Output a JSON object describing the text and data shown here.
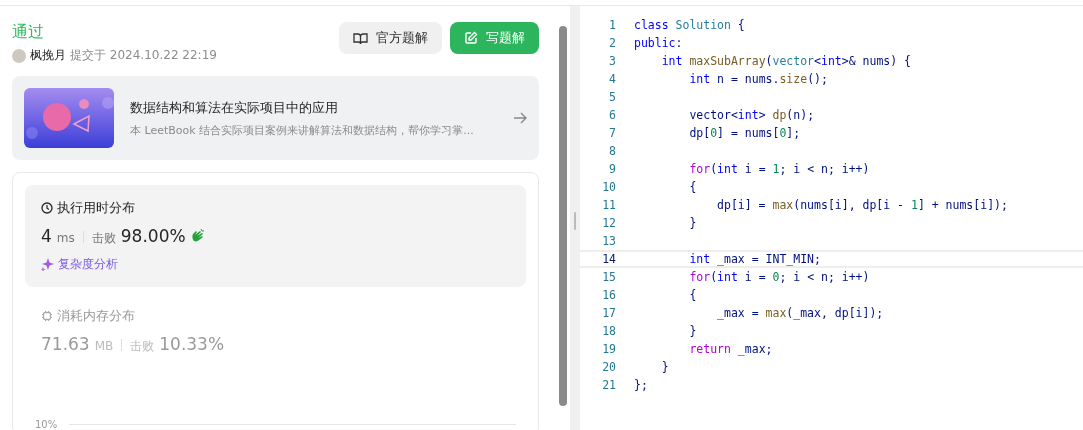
{
  "submission": {
    "status": "通过",
    "author": "枫挽月",
    "submitted": "提交于 2024.10.22 22:19"
  },
  "buttons": [
    {
      "kind": "secondary",
      "label": "官方题解"
    },
    {
      "kind": "primary",
      "label": "写题解"
    }
  ],
  "promo": {
    "title": "数据结构和算法在实际项目中的应用",
    "subtitle": "本 LeetBook 结合实际项目案例来讲解算法和数据结构，帮你学习掌..."
  },
  "stats": [
    {
      "kind": "time",
      "selected": true,
      "title": "执行用时分布",
      "value": "4",
      "unit": "ms",
      "beats_label": "击败",
      "beats": "98.00%",
      "link": "复杂度分析"
    },
    {
      "kind": "memory",
      "selected": false,
      "title": "消耗内存分布",
      "value": "71.63",
      "unit": "MB",
      "beats_label": "击败",
      "beats": "10.33%"
    }
  ],
  "chart": {
    "ytick_label": "10%"
  },
  "code": [
    {
      "number": "1",
      "current": false,
      "tokens": [
        {
          "kind": "keyword",
          "text": "class"
        },
        {
          "kind": "type",
          "text": " Solution"
        },
        {
          "kind": "plain",
          "text": " {"
        }
      ]
    },
    {
      "number": "2",
      "current": false,
      "tokens": [
        {
          "kind": "keyword",
          "text": "public"
        },
        {
          "kind": "plain",
          "text": ":"
        }
      ]
    },
    {
      "number": "3",
      "current": false,
      "tokens": [
        {
          "kind": "keyword",
          "text": "    int"
        },
        {
          "kind": "func",
          "text": " maxSubArray"
        },
        {
          "kind": "plain",
          "text": "("
        },
        {
          "kind": "type",
          "text": "vector"
        },
        {
          "kind": "plain",
          "text": "<"
        },
        {
          "kind": "keyword",
          "text": "int"
        },
        {
          "kind": "plain",
          "text": ">& nums) {"
        }
      ]
    },
    {
      "number": "4",
      "current": false,
      "tokens": [
        {
          "kind": "keyword",
          "text": "        int"
        },
        {
          "kind": "plain",
          "text": " n = nums."
        },
        {
          "kind": "func",
          "text": "size"
        },
        {
          "kind": "plain",
          "text": "();"
        }
      ]
    },
    {
      "number": "5",
      "current": false
    },
    {
      "number": "6",
      "current": false,
      "tokens": [
        {
          "kind": "plain",
          "text": "        vector<"
        },
        {
          "kind": "keyword",
          "text": "int"
        },
        {
          "kind": "plain",
          "text": "> "
        },
        {
          "kind": "func",
          "text": "dp"
        },
        {
          "kind": "plain",
          "text": "(n);"
        }
      ]
    },
    {
      "number": "7",
      "current": false,
      "tokens": [
        {
          "kind": "plain",
          "text": "        dp["
        },
        {
          "kind": "number",
          "text": "0"
        },
        {
          "kind": "plain",
          "text": "] = nums["
        },
        {
          "kind": "number",
          "text": "0"
        },
        {
          "kind": "plain",
          "text": "];"
        }
      ]
    },
    {
      "number": "8",
      "current": false
    },
    {
      "number": "9",
      "current": false,
      "tokens": [
        {
          "kind": "control",
          "text": "        for"
        },
        {
          "kind": "plain",
          "text": "("
        },
        {
          "kind": "keyword",
          "text": "int"
        },
        {
          "kind": "plain",
          "text": " i = "
        },
        {
          "kind": "number",
          "text": "1"
        },
        {
          "kind": "plain",
          "text": "; i < n; i++)"
        }
      ]
    },
    {
      "number": "10",
      "current": false,
      "tokens": [
        {
          "kind": "plain",
          "text": "        {"
        }
      ]
    },
    {
      "number": "11",
      "current": false,
      "tokens": [
        {
          "kind": "plain",
          "text": "            dp[i] = "
        },
        {
          "kind": "func",
          "text": "max"
        },
        {
          "kind": "plain",
          "text": "(nums[i], dp[i - "
        },
        {
          "kind": "number",
          "text": "1"
        },
        {
          "kind": "plain",
          "text": "] + nums[i]);"
        }
      ]
    },
    {
      "number": "12",
      "current": false,
      "tokens": [
        {
          "kind": "plain",
          "text": "        }"
        }
      ]
    },
    {
      "number": "13",
      "current": false
    },
    {
      "number": "14",
      "current": true,
      "tokens": [
        {
          "kind": "keyword",
          "text": "        int"
        },
        {
          "kind": "plain",
          "text": " _max = INT_MIN;"
        }
      ]
    },
    {
      "number": "15",
      "current": false,
      "tokens": [
        {
          "kind": "control",
          "text": "        for"
        },
        {
          "kind": "plain",
          "text": "("
        },
        {
          "kind": "keyword",
          "text": "int"
        },
        {
          "kind": "plain",
          "text": " i = "
        },
        {
          "kind": "number",
          "text": "0"
        },
        {
          "kind": "plain",
          "text": "; i < n; i++)"
        }
      ]
    },
    {
      "number": "16",
      "current": false,
      "tokens": [
        {
          "kind": "plain",
          "text": "        {"
        }
      ]
    },
    {
      "number": "17",
      "current": false,
      "tokens": [
        {
          "kind": "plain",
          "text": "            _max = "
        },
        {
          "kind": "func",
          "text": "max"
        },
        {
          "kind": "plain",
          "text": "(_max, dp[i]);"
        }
      ]
    },
    {
      "number": "18",
      "current": false,
      "tokens": [
        {
          "kind": "plain",
          "text": "        }"
        }
      ]
    },
    {
      "number": "19",
      "current": false,
      "tokens": [
        {
          "kind": "control",
          "text": "        return"
        },
        {
          "kind": "plain",
          "text": " _max;"
        }
      ]
    },
    {
      "number": "20",
      "current": false,
      "tokens": [
        {
          "kind": "plain",
          "text": "    }"
        }
      ]
    },
    {
      "number": "21",
      "current": false,
      "tokens": [
        {
          "kind": "plain",
          "text": "};"
        }
      ]
    }
  ]
}
